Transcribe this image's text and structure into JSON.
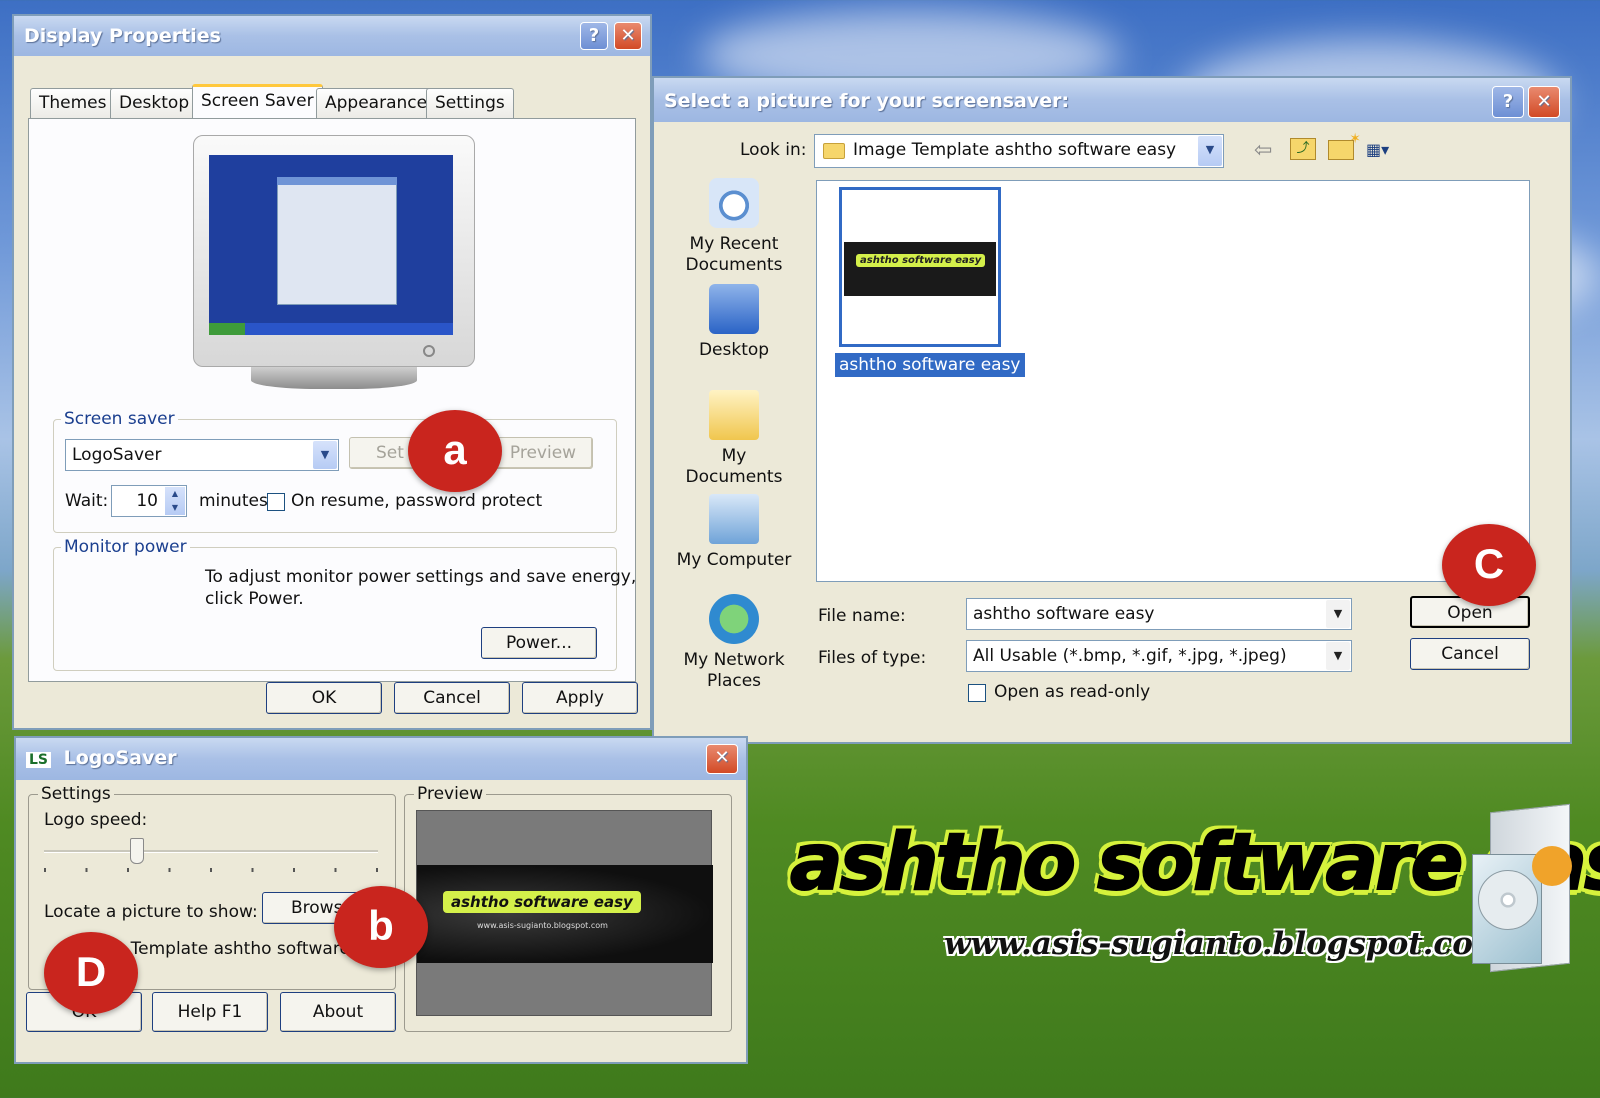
{
  "display_properties": {
    "title": "Display Properties",
    "tabs": [
      "Themes",
      "Desktop",
      "Screen Saver",
      "Appearance",
      "Settings"
    ],
    "active_tab": "Screen Saver",
    "screen_saver_group": "Screen saver",
    "screen_saver_value": "LogoSaver",
    "settings_button": "Set",
    "preview_button": "Preview",
    "wait_label": "Wait:",
    "wait_value": "10",
    "minutes_label": "minutes",
    "password_label": "On resume, password protect",
    "monitor_group": "Monitor power",
    "monitor_text_line1": "To adjust monitor power settings and save energy,",
    "monitor_text_line2": "click Power.",
    "power_button": "Power...",
    "ok": "OK",
    "cancel": "Cancel",
    "apply": "Apply"
  },
  "file_dialog": {
    "title": "Select a picture for your screensaver:",
    "look_in_label": "Look in:",
    "look_in_value": "Image Template ashtho software easy",
    "places": [
      "My Recent Documents",
      "Desktop",
      "My Documents",
      "My Computer",
      "My Network Places"
    ],
    "file_item_label": "ashtho software easy",
    "thumbnail_logo_text": "ashtho software easy",
    "file_name_label": "File name:",
    "file_name_value": "ashtho software easy",
    "files_of_type_label": "Files of type:",
    "files_of_type_value": "All Usable (*.bmp, *.gif, *.jpg, *.jpeg)",
    "read_only_label": "Open as read-only",
    "open": "Open",
    "cancel": "Cancel"
  },
  "logosaver": {
    "title": "LogoSaver",
    "app_icon": "LS",
    "settings_group": "Settings",
    "logo_speed_label": "Logo speed:",
    "logo_speed_level": 0.27,
    "locate_label": "Locate a picture to show:",
    "browse_button": "Browse",
    "path_value": "Image Template ashtho software easy\\a",
    "preview_group": "Preview",
    "preview_logo_text": "ashtho software easy",
    "preview_url": "www.asis-sugianto.blogspot.com",
    "ok": "OK",
    "help": "Help F1",
    "about": "About"
  },
  "badges": {
    "a": "a",
    "b": "b",
    "c": "C",
    "d": "D"
  },
  "branding": {
    "logo_text": "ashtho software easy",
    "url": "www.asis-sugianto.blogspot.com"
  }
}
